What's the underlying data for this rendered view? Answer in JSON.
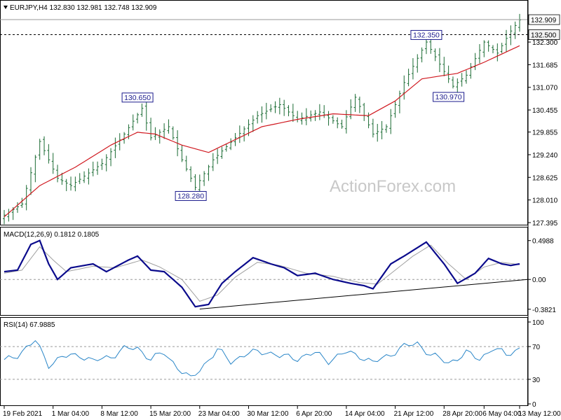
{
  "header": {
    "symbol_line": "EURJPY,H4  132.830 132.981 132.748 132.909"
  },
  "watermark": "ActionForex.com",
  "colors": {
    "candle": "#1a6b33",
    "ma": "#d0181f",
    "macd": "#0b0b8c",
    "signal": "#a0a0a0",
    "rsi": "#2a86c8",
    "annotation": "#1a1a8c"
  },
  "chart_data": [
    {
      "type": "candlestick",
      "name": "price",
      "title": "EURJPY,H4  132.830 132.981 132.748 132.909",
      "ylim": [
        127.395,
        133.1
      ],
      "y_ticks": [
        "132.300",
        "131.685",
        "131.070",
        "130.455",
        "129.855",
        "129.240",
        "128.625",
        "128.010",
        "127.395"
      ],
      "y_tick_values": [
        132.3,
        131.685,
        131.07,
        130.455,
        129.855,
        129.24,
        128.625,
        128.01,
        127.395
      ],
      "last_price_label": "132.909",
      "last_price": 132.909,
      "resistance_label": "132.500",
      "resistance": 132.5,
      "annotations": [
        {
          "text": "130.650",
          "value": 130.65,
          "x_index": 30
        },
        {
          "text": "128.280",
          "value": 128.28,
          "x_index": 42
        },
        {
          "text": "132.350",
          "value": 132.35,
          "x_index": 95
        },
        {
          "text": "130.970",
          "value": 130.97,
          "x_index": 100
        }
      ],
      "anchors": [
        [
          0,
          127.6
        ],
        [
          4,
          127.9
        ],
        [
          8,
          129.6
        ],
        [
          12,
          128.6
        ],
        [
          15,
          128.4
        ],
        [
          22,
          129.0
        ],
        [
          27,
          129.8
        ],
        [
          31,
          130.5
        ],
        [
          33,
          129.7
        ],
        [
          37,
          130.0
        ],
        [
          40,
          129.1
        ],
        [
          43,
          128.35
        ],
        [
          47,
          129.1
        ],
        [
          52,
          129.7
        ],
        [
          57,
          130.3
        ],
        [
          62,
          130.6
        ],
        [
          66,
          130.2
        ],
        [
          71,
          130.4
        ],
        [
          76,
          130.0
        ],
        [
          79,
          130.8
        ],
        [
          83,
          129.8
        ],
        [
          86,
          130.0
        ],
        [
          90,
          131.2
        ],
        [
          95,
          132.3
        ],
        [
          98,
          131.7
        ],
        [
          101,
          131.1
        ],
        [
          104,
          131.4
        ],
        [
          108,
          132.3
        ],
        [
          111,
          132.0
        ],
        [
          114,
          132.6
        ],
        [
          116,
          132.9
        ]
      ],
      "series": [
        {
          "name": "MA",
          "anchors": [
            [
              0,
              127.55
            ],
            [
              8,
              128.4
            ],
            [
              16,
              128.9
            ],
            [
              24,
              129.5
            ],
            [
              30,
              129.85
            ],
            [
              34,
              129.8
            ],
            [
              40,
              129.5
            ],
            [
              46,
              129.3
            ],
            [
              52,
              129.65
            ],
            [
              58,
              130.0
            ],
            [
              66,
              130.2
            ],
            [
              74,
              130.35
            ],
            [
              82,
              130.3
            ],
            [
              88,
              130.7
            ],
            [
              94,
              131.3
            ],
            [
              102,
              131.45
            ],
            [
              108,
              131.75
            ],
            [
              116,
              132.2
            ]
          ]
        }
      ]
    },
    {
      "type": "line",
      "name": "macd",
      "title": "MACD(12,26,9) 0.1812 0.1805",
      "ylim": [
        -0.42,
        0.55
      ],
      "y_ticks": [
        "0.4988",
        "0.00",
        "-0.3821"
      ],
      "y_tick_values": [
        0.4988,
        0.0,
        -0.3821
      ],
      "trendline": [
        [
          44,
          -0.38
        ],
        [
          125,
          0.0
        ]
      ],
      "series": [
        {
          "name": "MACD",
          "anchors": [
            [
              0,
              0.1
            ],
            [
              3,
              0.12
            ],
            [
              6,
              0.45
            ],
            [
              8,
              0.5
            ],
            [
              10,
              0.2
            ],
            [
              12,
              0.0
            ],
            [
              15,
              0.15
            ],
            [
              20,
              0.2
            ],
            [
              23,
              0.1
            ],
            [
              28,
              0.25
            ],
            [
              30,
              0.3
            ],
            [
              33,
              0.12
            ],
            [
              36,
              0.1
            ],
            [
              40,
              -0.1
            ],
            [
              43,
              -0.35
            ],
            [
              46,
              -0.32
            ],
            [
              49,
              -0.05
            ],
            [
              52,
              0.1
            ],
            [
              56,
              0.28
            ],
            [
              60,
              0.2
            ],
            [
              63,
              0.15
            ],
            [
              66,
              0.05
            ],
            [
              70,
              0.08
            ],
            [
              74,
              0.0
            ],
            [
              78,
              -0.05
            ],
            [
              81,
              -0.08
            ],
            [
              83,
              -0.12
            ],
            [
              87,
              0.2
            ],
            [
              90,
              0.3
            ],
            [
              95,
              0.48
            ],
            [
              99,
              0.2
            ],
            [
              102,
              -0.05
            ],
            [
              106,
              0.08
            ],
            [
              109,
              0.27
            ],
            [
              112,
              0.2
            ],
            [
              114,
              0.18
            ],
            [
              116,
              0.2
            ]
          ]
        },
        {
          "name": "Signal",
          "anchors": [
            [
              0,
              0.08
            ],
            [
              4,
              0.12
            ],
            [
              8,
              0.42
            ],
            [
              11,
              0.25
            ],
            [
              14,
              0.1
            ],
            [
              20,
              0.17
            ],
            [
              25,
              0.15
            ],
            [
              31,
              0.25
            ],
            [
              35,
              0.16
            ],
            [
              40,
              0.0
            ],
            [
              44,
              -0.28
            ],
            [
              48,
              -0.2
            ],
            [
              52,
              0.03
            ],
            [
              57,
              0.22
            ],
            [
              62,
              0.18
            ],
            [
              68,
              0.08
            ],
            [
              74,
              0.04
            ],
            [
              80,
              -0.04
            ],
            [
              84,
              -0.06
            ],
            [
              88,
              0.12
            ],
            [
              92,
              0.3
            ],
            [
              96,
              0.44
            ],
            [
              100,
              0.2
            ],
            [
              104,
              0.0
            ],
            [
              108,
              0.16
            ],
            [
              112,
              0.22
            ],
            [
              116,
              0.19
            ]
          ]
        }
      ]
    },
    {
      "type": "line",
      "name": "rsi",
      "title": "RSI(14) 67.9885",
      "ylim": [
        0,
        100
      ],
      "y_ticks": [
        "100",
        "70",
        "30",
        "0"
      ],
      "y_tick_values": [
        100,
        70,
        30,
        0
      ],
      "reference_lines": [
        70,
        30
      ],
      "series": [
        {
          "name": "RSI",
          "anchors": [
            [
              0,
              52
            ],
            [
              3,
              60
            ],
            [
              7,
              77
            ],
            [
              10,
              48
            ],
            [
              13,
              57
            ],
            [
              17,
              60
            ],
            [
              20,
              52
            ],
            [
              24,
              58
            ],
            [
              27,
              67
            ],
            [
              30,
              68
            ],
            [
              33,
              55
            ],
            [
              36,
              62
            ],
            [
              39,
              45
            ],
            [
              42,
              30
            ],
            [
              45,
              48
            ],
            [
              48,
              66
            ],
            [
              51,
              52
            ],
            [
              55,
              62
            ],
            [
              59,
              64
            ],
            [
              62,
              58
            ],
            [
              66,
              56
            ],
            [
              70,
              62
            ],
            [
              73,
              53
            ],
            [
              77,
              63
            ],
            [
              80,
              59
            ],
            [
              83,
              50
            ],
            [
              86,
              58
            ],
            [
              90,
              70
            ],
            [
              93,
              74
            ],
            [
              96,
              60
            ],
            [
              100,
              50
            ],
            [
              104,
              62
            ],
            [
              107,
              55
            ],
            [
              110,
              68
            ],
            [
              113,
              60
            ],
            [
              116,
              68
            ]
          ]
        }
      ]
    }
  ],
  "x_axis": {
    "tick_labels": [
      "19 Feb 2021",
      "1 Mar 04:00",
      "8 Mar 12:00",
      "15 Mar 20:00",
      "23 Mar 04:00",
      "30 Mar 12:00",
      "6 Apr 20:00",
      "14 Apr 04:00",
      "21 Apr 12:00",
      "28 Apr 20:00",
      "6 May 04:00",
      "13 May 12:00"
    ],
    "tick_index": [
      0,
      11,
      22,
      33,
      44,
      55,
      66,
      77,
      88,
      99,
      108,
      116
    ],
    "bar_count": 117
  }
}
